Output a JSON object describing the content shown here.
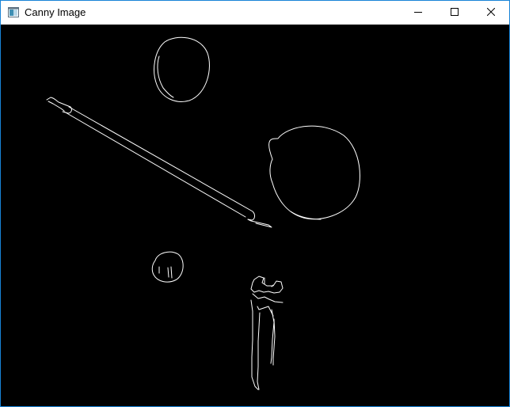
{
  "window": {
    "title": "Canny Image",
    "app_icon": "window-app-icon",
    "controls": {
      "minimize_icon": "minimize-icon",
      "maximize_icon": "maximize-icon",
      "close_icon": "close-icon"
    }
  },
  "colors": {
    "frame_border": "#1883d7",
    "titlebar_bg": "#ffffff",
    "canvas_bg": "#000000",
    "edge_stroke": "#ffffff"
  }
}
